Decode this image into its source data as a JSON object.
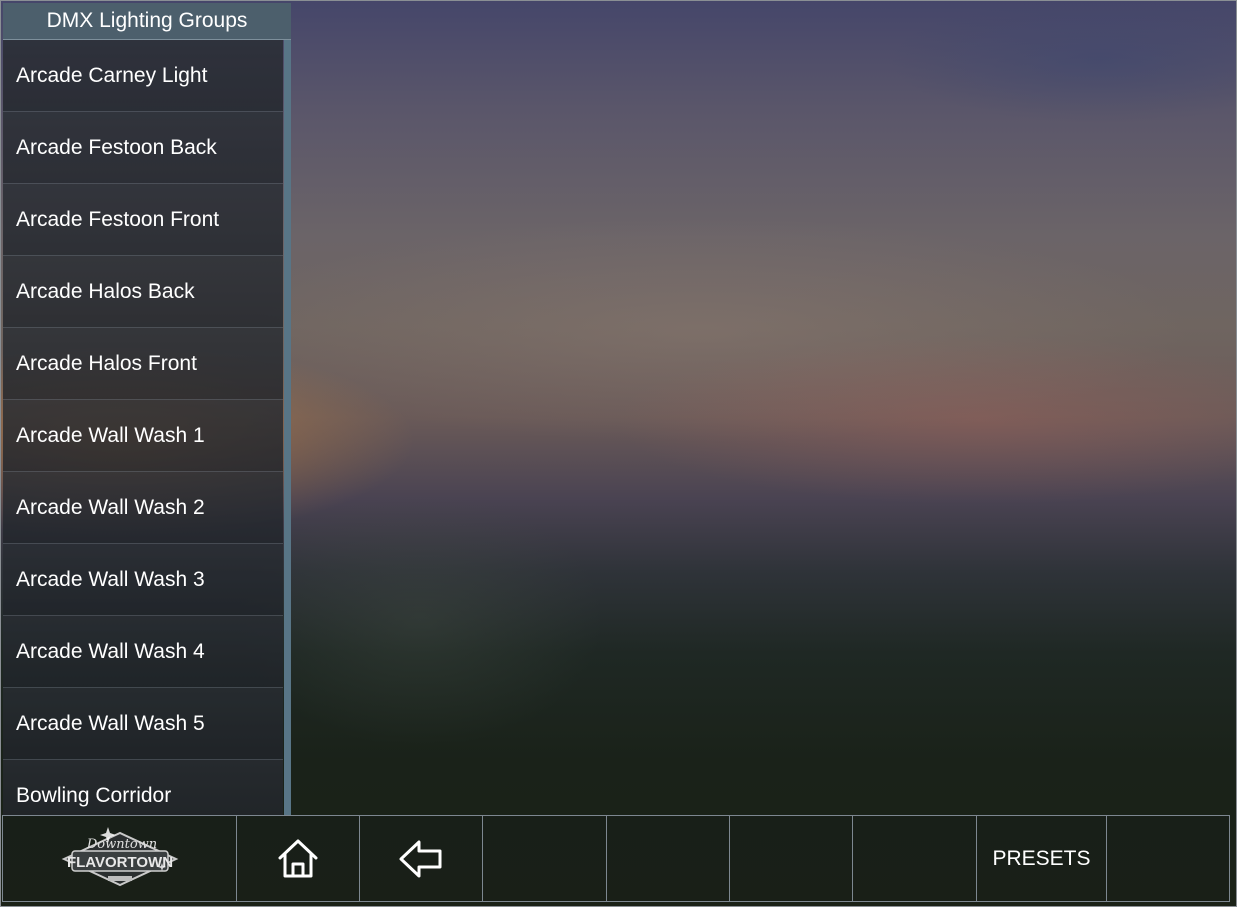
{
  "sidebar": {
    "title": "DMX Lighting Groups",
    "items": [
      {
        "label": "Arcade Carney Light"
      },
      {
        "label": "Arcade Festoon Back"
      },
      {
        "label": "Arcade Festoon Front"
      },
      {
        "label": "Arcade Halos Back"
      },
      {
        "label": "Arcade Halos Front"
      },
      {
        "label": "Arcade Wall Wash 1"
      },
      {
        "label": "Arcade Wall Wash 2"
      },
      {
        "label": "Arcade Wall Wash 3"
      },
      {
        "label": "Arcade Wall Wash 4"
      },
      {
        "label": "Arcade Wall Wash 5"
      },
      {
        "label": "Bowling Corridor"
      }
    ]
  },
  "toolbar": {
    "logo": {
      "script_text": "Downtown",
      "main_text": "FLAVORTOWN",
      "icon": "flavortown-logo"
    },
    "home_icon": "home-icon",
    "back_icon": "back-arrow-icon",
    "presets_label": "PRESETS"
  },
  "colors": {
    "sidebar_title_bg": "#4c5f6c",
    "scrollbar": "#587586",
    "text": "#ffffff"
  }
}
